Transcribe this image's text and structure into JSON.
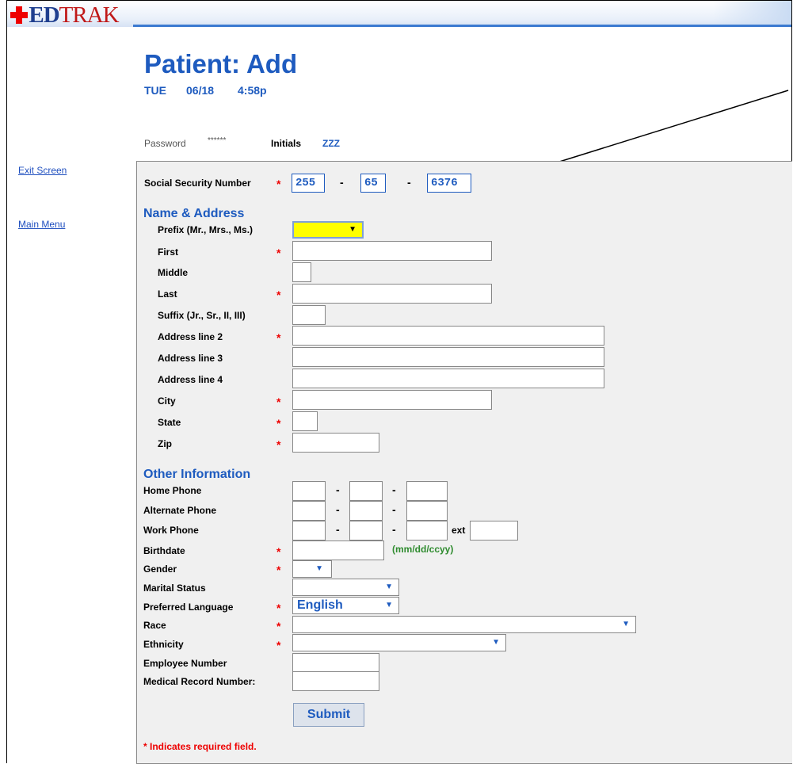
{
  "app": {
    "logo_text": "MEDTRAK",
    "logo_ed": "ED",
    "logo_trak": "TRAK"
  },
  "header": {
    "title": "Patient: Add",
    "day": "TUE",
    "date": "06/18",
    "time": "4:58p"
  },
  "auth": {
    "password_label": "Password",
    "password_value": "******",
    "initials_label": "Initials",
    "initials_value": "ZZZ"
  },
  "nav": {
    "exit": "Exit Screen",
    "main_menu": "Main Menu"
  },
  "ssn": {
    "label": "Social Security Number",
    "part1": "255",
    "part2": "65",
    "part3": "6376",
    "dash": "-"
  },
  "name_section": {
    "title": "Name & Address",
    "fields": [
      {
        "label": "Prefix (Mr., Mrs., Ms.)"
      },
      {
        "label": "First",
        "required": true
      },
      {
        "label": "Middle"
      },
      {
        "label": "Last",
        "required": true
      },
      {
        "label": "Suffix (Jr., Sr., II, III)"
      },
      {
        "label": "Address line 2",
        "required": true
      },
      {
        "label": "Address line 3"
      },
      {
        "label": "Address line 4"
      },
      {
        "label": "City",
        "required": true
      },
      {
        "label": "State",
        "required": true
      },
      {
        "label": "Zip",
        "required": true
      }
    ]
  },
  "other_section": {
    "title": "Other Information",
    "home_phone": "Home Phone",
    "alt_phone": "Alternate Phone",
    "work_phone": "Work Phone",
    "ext": "ext",
    "birthdate": "Birthdate",
    "birth_hint": "(mm/dd/ccyy)",
    "gender": "Gender",
    "marital": "Marital Status",
    "language": "Preferred Language",
    "language_value": "English",
    "race": "Race",
    "ethnicity": "Ethnicity",
    "employee": "Employee Number",
    "mrn": "Medical Record Number:"
  },
  "required_marker": "*",
  "submit_label": "Submit",
  "required_note": "* Indicates required field.",
  "colors": {
    "accent": "#1e5bbf",
    "required": "#ee0000",
    "prefix_highlight": "#ffff00",
    "panel": "#f0f0f0"
  }
}
